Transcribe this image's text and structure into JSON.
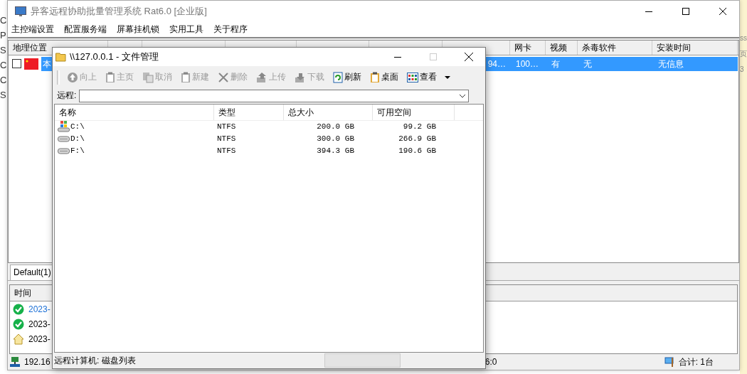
{
  "desktop": {
    "left_fragments": [
      "C",
      "P",
      "S",
      "C",
      "C",
      "S"
    ],
    "right_fragments": [
      "ss",
      "页",
      "3"
    ]
  },
  "main_window": {
    "title": "异客远程协助批量管理系统 Rat6.0  [企业版]",
    "menu": [
      "主控端设置",
      "配置服务端",
      "屏幕挂机锁",
      "实用工具",
      "关于程序"
    ],
    "columns": [
      {
        "label": "地理位置"
      },
      {},
      {},
      {},
      {},
      {},
      {},
      {
        "label": "网卡"
      },
      {
        "label": "视频"
      },
      {
        "label": "杀毒软件"
      },
      {
        "label": "安装时间"
      }
    ],
    "rows": [
      {
        "checked": false,
        "selected": true,
        "location": "本",
        "disk_memory": "94…",
        "nic": "100…",
        "video": "有",
        "antivirus": "无",
        "install_time": "无信息"
      }
    ],
    "groups": [
      {
        "label": "Default(1)",
        "selected": true
      }
    ],
    "log": {
      "column": "时间",
      "rows": [
        {
          "kind": "success",
          "time": "2023-",
          "selected": true
        },
        {
          "kind": "success",
          "time": "2023-",
          "selected": false
        },
        {
          "kind": "home",
          "time": "2023-",
          "selected": false
        }
      ]
    },
    "status_bar": {
      "address": "192.16",
      "fragment": "6:0",
      "total": "合计: 1台"
    }
  },
  "dialog": {
    "title": "\\\\127.0.0.1 - 文件管理",
    "toolbar": [
      {
        "kind": "up",
        "label": "向上",
        "disabled": true
      },
      {
        "kind": "clipboard",
        "label": "主页",
        "disabled": true
      },
      {
        "kind": "copy",
        "label": "取消",
        "disabled": true
      },
      {
        "kind": "clipboard",
        "label": "新建",
        "disabled": true
      },
      {
        "kind": "delete",
        "label": "删除",
        "disabled": true
      },
      {
        "kind": "upload",
        "label": "上传",
        "disabled": true
      },
      {
        "kind": "download",
        "label": "下载",
        "disabled": true
      },
      {
        "kind": "refresh",
        "label": "刷新",
        "disabled": false
      },
      {
        "kind": "clipboard",
        "label": "桌面",
        "disabled": false
      },
      {
        "kind": "view",
        "label": "查看",
        "disabled": false
      }
    ],
    "address_label": "远程:",
    "columns": [
      "名称",
      "类型",
      "总大小",
      "可用空间"
    ],
    "rows": [
      {
        "kind": "system",
        "name": "C:\\",
        "type": "NTFS",
        "total": "200.0 GB",
        "free": "99.2 GB"
      },
      {
        "kind": "drive",
        "name": "D:\\",
        "type": "NTFS",
        "total": "300.0 GB",
        "free": "266.9 GB"
      },
      {
        "kind": "drive",
        "name": "F:\\",
        "type": "NTFS",
        "total": "394.3 GB",
        "free": "190.6 GB"
      }
    ],
    "status": "远程计算机: 磁盘列表"
  }
}
